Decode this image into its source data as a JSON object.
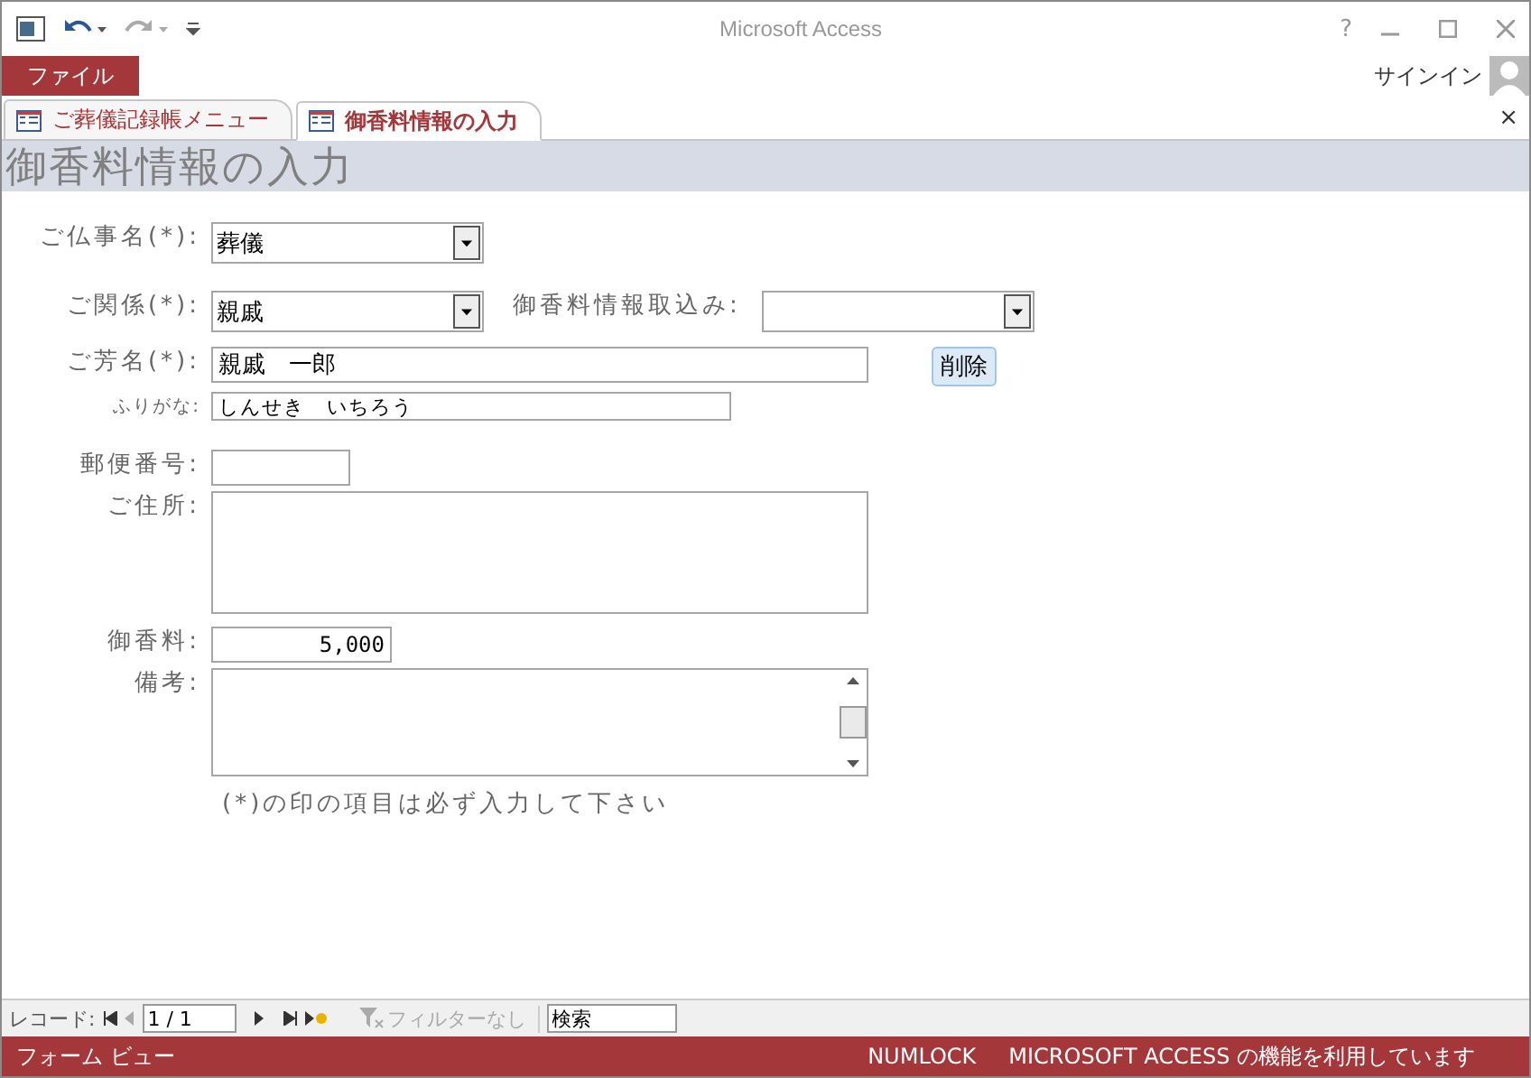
{
  "window": {
    "title": "Microsoft Access",
    "help": "?"
  },
  "ribbon": {
    "file_tab": "ファイル",
    "sign_in": "サインイン"
  },
  "doc_tabs": [
    {
      "label": "ご葬儀記録帳メニュー",
      "selected": false
    },
    {
      "label": "御香料情報の入力",
      "selected": true
    }
  ],
  "close_tab": "×",
  "form": {
    "title": "御香料情報の入力",
    "rows": [
      {
        "label": "ご仏事名(*):",
        "kind": "combo",
        "value": "葬儀"
      },
      {
        "label": "ご関係(*):",
        "kind": "combo",
        "value": "親戚",
        "extra": {
          "label": "御香料情報取込み:",
          "kind": "combo"
        }
      },
      {
        "label": "ご芳名(*):",
        "kind": "text",
        "value": "親戚　一郎",
        "button": "削除"
      },
      {
        "label": "ふりがな:",
        "kind": "small",
        "value": "しんせき　いちろう"
      },
      {
        "label": "郵便番号:",
        "kind": "text"
      },
      {
        "label": "ご住所:",
        "kind": "area"
      },
      {
        "label": "御香料:",
        "kind": "number",
        "value": "5,000"
      },
      {
        "label": "備考:",
        "kind": "memo"
      }
    ],
    "note": "(*)の印の項目は必ず入力して下さい"
  },
  "record_nav": {
    "label": "レコード:",
    "position": "1 / 1",
    "filter": "フィルターなし",
    "search": "検索"
  },
  "status_bar": {
    "view": "フォーム ビュー",
    "numlock": "NUMLOCK",
    "message": "MICROSOFT ACCESS の機能を利用しています"
  }
}
